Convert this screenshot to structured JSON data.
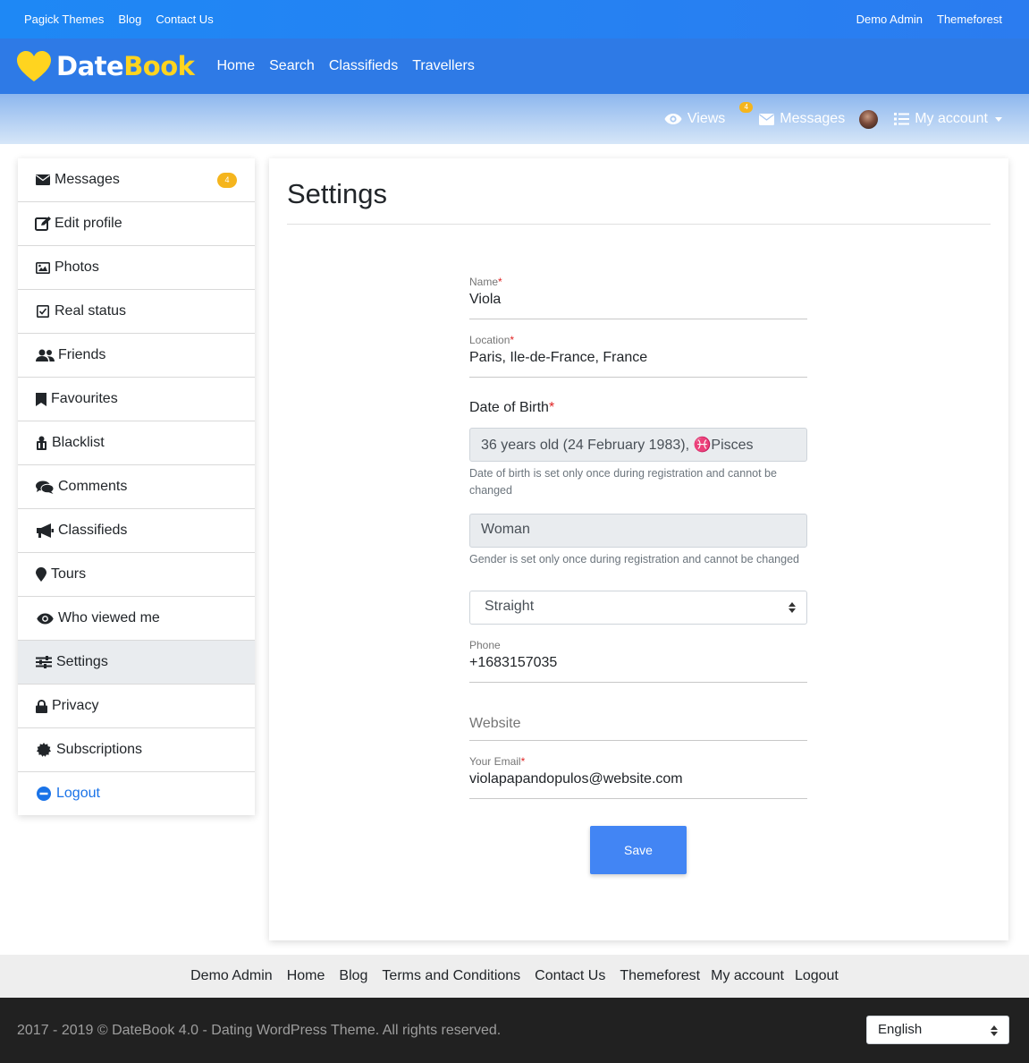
{
  "topbar": {
    "left_links": [
      "Pagick Themes",
      "Blog",
      "Contact Us"
    ],
    "right_links": [
      "Demo Admin",
      "Themeforest"
    ]
  },
  "header": {
    "logo_part1": "Date",
    "logo_part2": "Book",
    "nav": [
      "Home",
      "Search",
      "Classifieds",
      "Travellers"
    ],
    "logo_colors": {
      "heart": "#ffd41f",
      "book": "#ffd41f"
    }
  },
  "subbar": {
    "views": "Views",
    "messages": "Messages",
    "messages_badge": "4",
    "my_account": "My account"
  },
  "sidebar": {
    "items": [
      {
        "label": "Messages",
        "icon": "envelope-icon",
        "badge": "4"
      },
      {
        "label": "Edit profile",
        "icon": "edit-icon"
      },
      {
        "label": "Photos",
        "icon": "image-icon"
      },
      {
        "label": "Real status",
        "icon": "checkbox-icon"
      },
      {
        "label": "Friends",
        "icon": "users-icon"
      },
      {
        "label": "Favourites",
        "icon": "bookmark-icon"
      },
      {
        "label": "Blacklist",
        "icon": "blacklist-icon"
      },
      {
        "label": "Comments",
        "icon": "comments-icon"
      },
      {
        "label": "Classifieds",
        "icon": "megaphone-icon"
      },
      {
        "label": "Tours",
        "icon": "map-marker-icon"
      },
      {
        "label": "Who viewed me",
        "icon": "eye-icon"
      },
      {
        "label": "Settings",
        "icon": "sliders-icon",
        "active": true
      },
      {
        "label": "Privacy",
        "icon": "lock-icon"
      },
      {
        "label": "Subscriptions",
        "icon": "certificate-icon"
      },
      {
        "label": "Logout",
        "icon": "minus-circle-icon"
      }
    ]
  },
  "main": {
    "title": "Settings",
    "name_label": "Name",
    "name_value": "Viola",
    "location_label": "Location",
    "location_value": "Paris, Ile-de-France, France",
    "dob_label": "Date of Birth",
    "dob_value": "36 years old (24 February 1983),",
    "zodiac_symbol": "♓",
    "zodiac": "Pisces",
    "dob_help": "Date of birth is set only once during registration and cannot be changed",
    "gender_value": "Woman",
    "gender_help": "Gender is set only once during registration and cannot be changed",
    "orientation_value": "Straight",
    "phone_label": "Phone",
    "phone_value": "+1683157035",
    "website_placeholder": "Website",
    "email_label": "Your Email",
    "email_value": "violapapandopulos@website.com",
    "required_mark": "*",
    "save_label": "Save"
  },
  "footer_nav": [
    "Demo Admin",
    "Home",
    "Blog",
    "Terms and Conditions",
    "Contact Us",
    "Themeforest",
    "My account",
    "Logout"
  ],
  "footer": {
    "copyright": "2017 - 2019 © DateBook 4.0 - Dating WordPress Theme. All rights reserved.",
    "language": "English"
  },
  "colors": {
    "topbar": "#1e88f5",
    "mainbar": "#2e7ae6",
    "badge": "#f5b51d",
    "save_button": "#4285f4",
    "link": "#1a73e8"
  }
}
